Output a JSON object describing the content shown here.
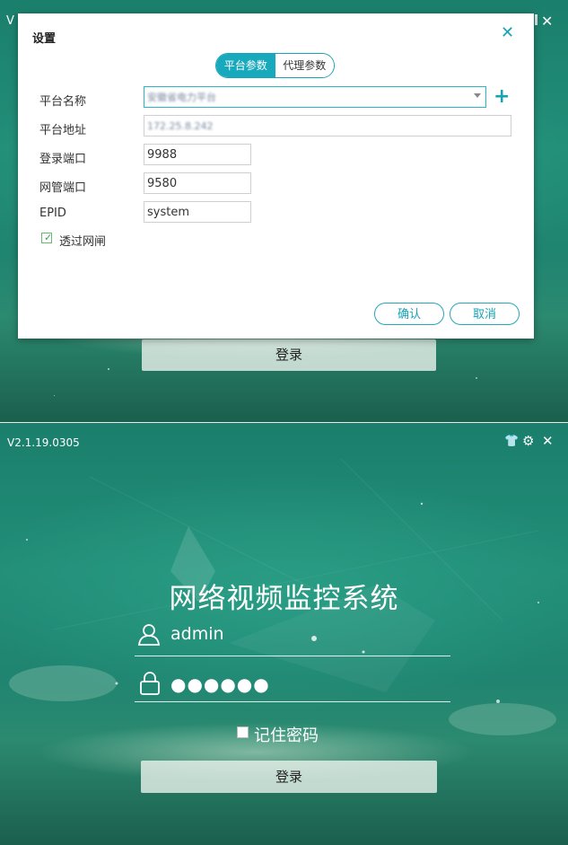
{
  "top_panel": {
    "title_fragment": "V",
    "login_button_label": "登录",
    "dialog": {
      "title": "设置",
      "tabs": [
        {
          "label": "平台参数",
          "active": true
        },
        {
          "label": "代理参数",
          "active": false
        }
      ],
      "fields": {
        "platform_name": {
          "label": "平台名称",
          "value": "安徽省电力平台"
        },
        "platform_address": {
          "label": "平台地址",
          "value": "172.25.8.242"
        },
        "login_port": {
          "label": "登录端口",
          "value": "9988"
        },
        "gateway_port": {
          "label": "网管端口",
          "value": "9580"
        },
        "epid": {
          "label": "EPID",
          "value": "system"
        }
      },
      "gateway_checkbox": {
        "label": "透过网闸",
        "checked": true
      },
      "confirm_label": "确认",
      "cancel_label": "取消"
    }
  },
  "bottom_panel": {
    "version": "V2.1.19.0305",
    "app_title": "网络视频监控系统",
    "username": "admin",
    "password_mask": "●●●●●●",
    "remember_label": "记住密码",
    "remember_checked": false,
    "login_button_label": "登录"
  },
  "colors": {
    "accent": "#19a9bc",
    "background": "#1f7b68",
    "check": "#3aa14a"
  },
  "icons": [
    "close-icon",
    "plus-icon",
    "dropdown-arrow-icon",
    "checkbox-icon",
    "skin-icon",
    "gear-icon",
    "user-icon",
    "lock-icon"
  ]
}
